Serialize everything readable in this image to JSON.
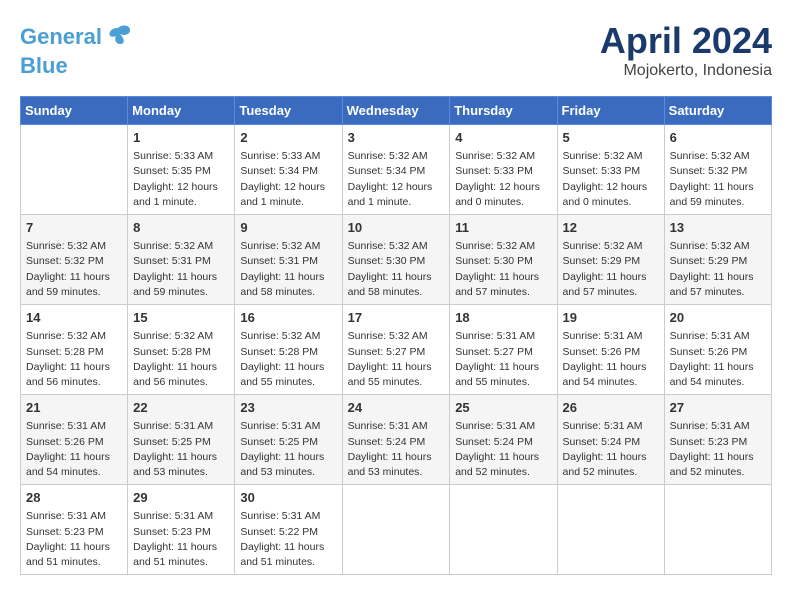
{
  "header": {
    "logo_general": "General",
    "logo_blue": "Blue",
    "title": "April 2024",
    "location": "Mojokerto, Indonesia"
  },
  "calendar": {
    "headers": [
      "Sunday",
      "Monday",
      "Tuesday",
      "Wednesday",
      "Thursday",
      "Friday",
      "Saturday"
    ],
    "weeks": [
      [
        {
          "day": "",
          "info": ""
        },
        {
          "day": "1",
          "info": "Sunrise: 5:33 AM\nSunset: 5:35 PM\nDaylight: 12 hours\nand 1 minute."
        },
        {
          "day": "2",
          "info": "Sunrise: 5:33 AM\nSunset: 5:34 PM\nDaylight: 12 hours\nand 1 minute."
        },
        {
          "day": "3",
          "info": "Sunrise: 5:32 AM\nSunset: 5:34 PM\nDaylight: 12 hours\nand 1 minute."
        },
        {
          "day": "4",
          "info": "Sunrise: 5:32 AM\nSunset: 5:33 PM\nDaylight: 12 hours\nand 0 minutes."
        },
        {
          "day": "5",
          "info": "Sunrise: 5:32 AM\nSunset: 5:33 PM\nDaylight: 12 hours\nand 0 minutes."
        },
        {
          "day": "6",
          "info": "Sunrise: 5:32 AM\nSunset: 5:32 PM\nDaylight: 11 hours\nand 59 minutes."
        }
      ],
      [
        {
          "day": "7",
          "info": "Sunrise: 5:32 AM\nSunset: 5:32 PM\nDaylight: 11 hours\nand 59 minutes."
        },
        {
          "day": "8",
          "info": "Sunrise: 5:32 AM\nSunset: 5:31 PM\nDaylight: 11 hours\nand 59 minutes."
        },
        {
          "day": "9",
          "info": "Sunrise: 5:32 AM\nSunset: 5:31 PM\nDaylight: 11 hours\nand 58 minutes."
        },
        {
          "day": "10",
          "info": "Sunrise: 5:32 AM\nSunset: 5:30 PM\nDaylight: 11 hours\nand 58 minutes."
        },
        {
          "day": "11",
          "info": "Sunrise: 5:32 AM\nSunset: 5:30 PM\nDaylight: 11 hours\nand 57 minutes."
        },
        {
          "day": "12",
          "info": "Sunrise: 5:32 AM\nSunset: 5:29 PM\nDaylight: 11 hours\nand 57 minutes."
        },
        {
          "day": "13",
          "info": "Sunrise: 5:32 AM\nSunset: 5:29 PM\nDaylight: 11 hours\nand 57 minutes."
        }
      ],
      [
        {
          "day": "14",
          "info": "Sunrise: 5:32 AM\nSunset: 5:28 PM\nDaylight: 11 hours\nand 56 minutes."
        },
        {
          "day": "15",
          "info": "Sunrise: 5:32 AM\nSunset: 5:28 PM\nDaylight: 11 hours\nand 56 minutes."
        },
        {
          "day": "16",
          "info": "Sunrise: 5:32 AM\nSunset: 5:28 PM\nDaylight: 11 hours\nand 55 minutes."
        },
        {
          "day": "17",
          "info": "Sunrise: 5:32 AM\nSunset: 5:27 PM\nDaylight: 11 hours\nand 55 minutes."
        },
        {
          "day": "18",
          "info": "Sunrise: 5:31 AM\nSunset: 5:27 PM\nDaylight: 11 hours\nand 55 minutes."
        },
        {
          "day": "19",
          "info": "Sunrise: 5:31 AM\nSunset: 5:26 PM\nDaylight: 11 hours\nand 54 minutes."
        },
        {
          "day": "20",
          "info": "Sunrise: 5:31 AM\nSunset: 5:26 PM\nDaylight: 11 hours\nand 54 minutes."
        }
      ],
      [
        {
          "day": "21",
          "info": "Sunrise: 5:31 AM\nSunset: 5:26 PM\nDaylight: 11 hours\nand 54 minutes."
        },
        {
          "day": "22",
          "info": "Sunrise: 5:31 AM\nSunset: 5:25 PM\nDaylight: 11 hours\nand 53 minutes."
        },
        {
          "day": "23",
          "info": "Sunrise: 5:31 AM\nSunset: 5:25 PM\nDaylight: 11 hours\nand 53 minutes."
        },
        {
          "day": "24",
          "info": "Sunrise: 5:31 AM\nSunset: 5:24 PM\nDaylight: 11 hours\nand 53 minutes."
        },
        {
          "day": "25",
          "info": "Sunrise: 5:31 AM\nSunset: 5:24 PM\nDaylight: 11 hours\nand 52 minutes."
        },
        {
          "day": "26",
          "info": "Sunrise: 5:31 AM\nSunset: 5:24 PM\nDaylight: 11 hours\nand 52 minutes."
        },
        {
          "day": "27",
          "info": "Sunrise: 5:31 AM\nSunset: 5:23 PM\nDaylight: 11 hours\nand 52 minutes."
        }
      ],
      [
        {
          "day": "28",
          "info": "Sunrise: 5:31 AM\nSunset: 5:23 PM\nDaylight: 11 hours\nand 51 minutes."
        },
        {
          "day": "29",
          "info": "Sunrise: 5:31 AM\nSunset: 5:23 PM\nDaylight: 11 hours\nand 51 minutes."
        },
        {
          "day": "30",
          "info": "Sunrise: 5:31 AM\nSunset: 5:22 PM\nDaylight: 11 hours\nand 51 minutes."
        },
        {
          "day": "",
          "info": ""
        },
        {
          "day": "",
          "info": ""
        },
        {
          "day": "",
          "info": ""
        },
        {
          "day": "",
          "info": ""
        }
      ]
    ]
  }
}
